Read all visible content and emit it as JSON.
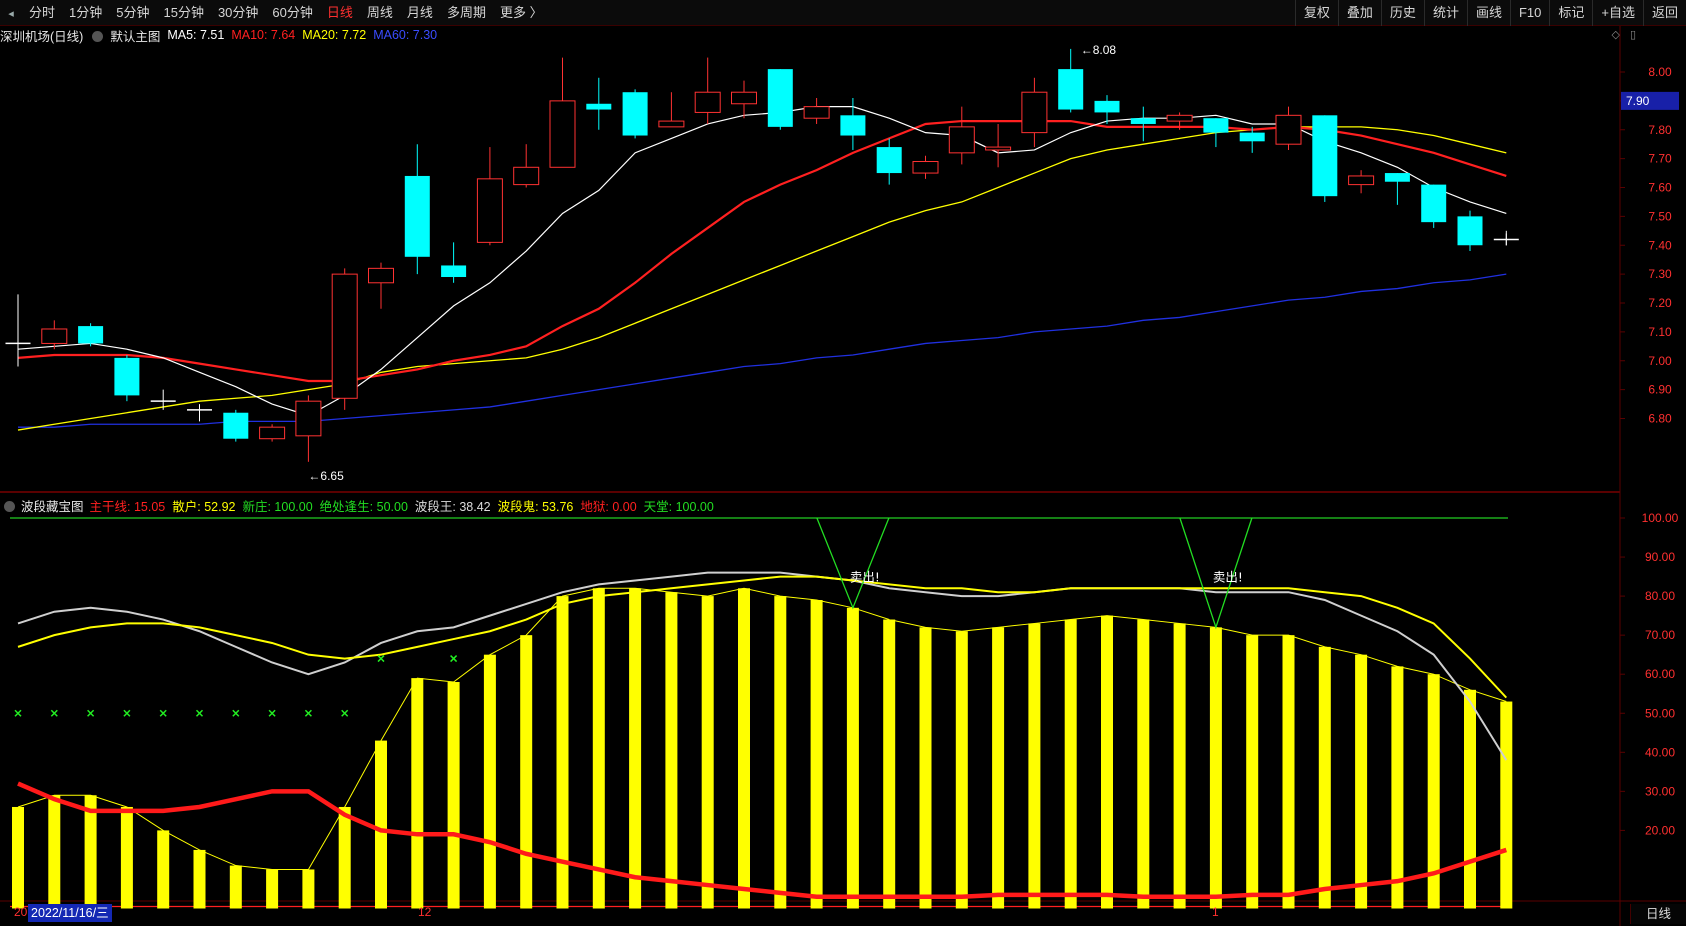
{
  "toolbar": {
    "periods": [
      "分时",
      "1分钟",
      "5分钟",
      "15分钟",
      "30分钟",
      "60分钟",
      "日线",
      "周线",
      "月线",
      "多周期",
      "更多 〉"
    ],
    "active_period": "日线",
    "tools": [
      "复权",
      "叠加",
      "历史",
      "统计",
      "画线",
      "F10",
      "标记",
      "+自选",
      "返回"
    ]
  },
  "main_chart": {
    "stock_name": "深圳机场(日线)",
    "template": "默认主图",
    "ma_legend": [
      {
        "label": "MA5: 7.51",
        "color": "#ffffff"
      },
      {
        "label": "MA10: 7.64",
        "color": "#ff2020"
      },
      {
        "label": "MA20: 7.72",
        "color": "#ffff00"
      },
      {
        "label": "MA60: 7.30",
        "color": "#3a4cff"
      }
    ],
    "high_label": "8.08",
    "low_label": "6.65",
    "current_price": "7.90",
    "y_ticks": [
      "8.00",
      "7.90",
      "7.80",
      "7.70",
      "7.60",
      "7.50",
      "7.40",
      "7.30",
      "7.20",
      "7.10",
      "7.00",
      "6.90",
      "6.80"
    ]
  },
  "indicator": {
    "name": "波段藏宝图",
    "legend": [
      {
        "label": "主干线: 15.05",
        "color": "#ff2020"
      },
      {
        "label": "散户: 52.92",
        "color": "#ffff00"
      },
      {
        "label": "新庄: 100.00",
        "color": "#22dd22"
      },
      {
        "label": "绝处逢生: 50.00",
        "color": "#22dd22"
      },
      {
        "label": "波段王: 38.42",
        "color": "#dddddd"
      },
      {
        "label": "波段鬼: 53.76",
        "color": "#ffff00"
      },
      {
        "label": "地狱: 0.00",
        "color": "#ff2020"
      },
      {
        "label": "天堂: 100.00",
        "color": "#22dd22"
      }
    ],
    "y_ticks": [
      "100.00",
      "90.00",
      "80.00",
      "70.00",
      "60.00",
      "50.00",
      "40.00",
      "30.00",
      "20.00"
    ],
    "sell_labels": [
      "卖出!",
      "卖出!"
    ]
  },
  "x_axis": {
    "marks": [
      "20",
      "12",
      "1"
    ],
    "cursor_date": "2022/11/16/三"
  },
  "chart_data": {
    "type": "candlestick",
    "candles": [
      {
        "o": 7.06,
        "c": 7.06,
        "h": 7.23,
        "l": 6.98
      },
      {
        "o": 7.06,
        "c": 7.11,
        "h": 7.14,
        "l": 7.04
      },
      {
        "o": 7.12,
        "c": 7.06,
        "h": 7.13,
        "l": 7.05
      },
      {
        "o": 7.01,
        "c": 6.88,
        "h": 7.02,
        "l": 6.86
      },
      {
        "o": 6.86,
        "c": 6.86,
        "h": 6.9,
        "l": 6.83
      },
      {
        "o": 6.83,
        "c": 6.83,
        "h": 6.85,
        "l": 6.79
      },
      {
        "o": 6.82,
        "c": 6.73,
        "h": 6.83,
        "l": 6.72
      },
      {
        "o": 6.73,
        "c": 6.77,
        "h": 6.78,
        "l": 6.72
      },
      {
        "o": 6.74,
        "c": 6.86,
        "h": 6.88,
        "l": 6.65
      },
      {
        "o": 6.87,
        "c": 7.3,
        "h": 7.32,
        "l": 6.83
      },
      {
        "o": 7.27,
        "c": 7.32,
        "h": 7.34,
        "l": 7.18
      },
      {
        "o": 7.64,
        "c": 7.36,
        "h": 7.75,
        "l": 7.3
      },
      {
        "o": 7.33,
        "c": 7.29,
        "h": 7.41,
        "l": 7.27
      },
      {
        "o": 7.41,
        "c": 7.63,
        "h": 7.74,
        "l": 7.4
      },
      {
        "o": 7.61,
        "c": 7.67,
        "h": 7.75,
        "l": 7.6
      },
      {
        "o": 7.67,
        "c": 7.9,
        "h": 8.05,
        "l": 7.67
      },
      {
        "o": 7.89,
        "c": 7.87,
        "h": 7.98,
        "l": 7.8
      },
      {
        "o": 7.93,
        "c": 7.78,
        "h": 7.94,
        "l": 7.77
      },
      {
        "o": 7.81,
        "c": 7.83,
        "h": 7.93,
        "l": 7.81
      },
      {
        "o": 7.86,
        "c": 7.93,
        "h": 8.05,
        "l": 7.82
      },
      {
        "o": 7.89,
        "c": 7.93,
        "h": 7.97,
        "l": 7.84
      },
      {
        "o": 8.01,
        "c": 7.81,
        "h": 8.01,
        "l": 7.8
      },
      {
        "o": 7.84,
        "c": 7.88,
        "h": 7.91,
        "l": 7.82
      },
      {
        "o": 7.85,
        "c": 7.78,
        "h": 7.91,
        "l": 7.73
      },
      {
        "o": 7.74,
        "c": 7.65,
        "h": 7.77,
        "l": 7.61
      },
      {
        "o": 7.65,
        "c": 7.69,
        "h": 7.71,
        "l": 7.63
      },
      {
        "o": 7.72,
        "c": 7.81,
        "h": 7.88,
        "l": 7.68
      },
      {
        "o": 7.73,
        "c": 7.74,
        "h": 7.82,
        "l": 7.67
      },
      {
        "o": 7.79,
        "c": 7.93,
        "h": 7.98,
        "l": 7.74
      },
      {
        "o": 8.01,
        "c": 7.87,
        "h": 8.08,
        "l": 7.86
      },
      {
        "o": 7.9,
        "c": 7.86,
        "h": 7.92,
        "l": 7.82
      },
      {
        "o": 7.84,
        "c": 7.82,
        "h": 7.88,
        "l": 7.76
      },
      {
        "o": 7.83,
        "c": 7.85,
        "h": 7.86,
        "l": 7.8
      },
      {
        "o": 7.84,
        "c": 7.79,
        "h": 7.84,
        "l": 7.74
      },
      {
        "o": 7.79,
        "c": 7.76,
        "h": 7.81,
        "l": 7.72
      },
      {
        "o": 7.75,
        "c": 7.85,
        "h": 7.88,
        "l": 7.73
      },
      {
        "o": 7.85,
        "c": 7.57,
        "h": 7.85,
        "l": 7.55
      },
      {
        "o": 7.61,
        "c": 7.64,
        "h": 7.66,
        "l": 7.58
      },
      {
        "o": 7.65,
        "c": 7.62,
        "h": 7.65,
        "l": 7.54
      },
      {
        "o": 7.61,
        "c": 7.48,
        "h": 7.61,
        "l": 7.46
      },
      {
        "o": 7.5,
        "c": 7.4,
        "h": 7.52,
        "l": 7.38
      },
      {
        "o": 7.42,
        "c": 7.42,
        "h": 7.45,
        "l": 7.4
      }
    ],
    "ma5": [
      7.04,
      7.05,
      7.06,
      7.04,
      7.01,
      6.96,
      6.91,
      6.85,
      6.81,
      6.88,
      6.97,
      7.08,
      7.19,
      7.27,
      7.38,
      7.51,
      7.59,
      7.72,
      7.77,
      7.82,
      7.85,
      7.86,
      7.88,
      7.88,
      7.84,
      7.79,
      7.78,
      7.72,
      7.73,
      7.79,
      7.83,
      7.84,
      7.84,
      7.85,
      7.82,
      7.82,
      7.76,
      7.72,
      7.67,
      7.6,
      7.55,
      7.51
    ],
    "ma10": [
      7.01,
      7.02,
      7.02,
      7.02,
      7.01,
      6.99,
      6.97,
      6.95,
      6.93,
      6.93,
      6.95,
      6.97,
      7.0,
      7.02,
      7.05,
      7.12,
      7.18,
      7.27,
      7.37,
      7.46,
      7.55,
      7.61,
      7.66,
      7.72,
      7.77,
      7.82,
      7.83,
      7.83,
      7.83,
      7.83,
      7.81,
      7.81,
      7.81,
      7.81,
      7.8,
      7.81,
      7.8,
      7.78,
      7.75,
      7.72,
      7.68,
      7.64
    ],
    "ma20": [
      6.76,
      6.78,
      6.8,
      6.82,
      6.84,
      6.86,
      6.87,
      6.88,
      6.9,
      6.92,
      6.96,
      6.98,
      6.99,
      7.0,
      7.01,
      7.04,
      7.08,
      7.13,
      7.18,
      7.23,
      7.28,
      7.33,
      7.38,
      7.43,
      7.48,
      7.52,
      7.55,
      7.6,
      7.65,
      7.7,
      7.73,
      7.75,
      7.77,
      7.79,
      7.8,
      7.81,
      7.81,
      7.81,
      7.8,
      7.78,
      7.75,
      7.72
    ],
    "ma60": [
      6.77,
      6.77,
      6.78,
      6.78,
      6.78,
      6.78,
      6.79,
      6.79,
      6.79,
      6.8,
      6.81,
      6.82,
      6.83,
      6.84,
      6.86,
      6.88,
      6.9,
      6.92,
      6.94,
      6.96,
      6.98,
      6.99,
      7.01,
      7.02,
      7.04,
      7.06,
      7.07,
      7.08,
      7.1,
      7.11,
      7.12,
      7.14,
      7.15,
      7.17,
      7.19,
      7.21,
      7.22,
      7.24,
      7.25,
      7.27,
      7.28,
      7.3
    ],
    "ind_bars": [
      26,
      29,
      29,
      26,
      20,
      15,
      11,
      10,
      10,
      26,
      43,
      59,
      58,
      65,
      70,
      80,
      82,
      82,
      81,
      80,
      82,
      80,
      79,
      77,
      74,
      72,
      71,
      72,
      73,
      74,
      75,
      74,
      73,
      72,
      70,
      70,
      67,
      65,
      62,
      60,
      56,
      53
    ],
    "ind_red": [
      32,
      28,
      25,
      25,
      25,
      26,
      28,
      30,
      30,
      24,
      20,
      19,
      19,
      17,
      14,
      12,
      10,
      8,
      7,
      6,
      5,
      4,
      3,
      3,
      3,
      3,
      3,
      3.5,
      3.5,
      3.5,
      3.5,
      3,
      3,
      3,
      3.5,
      3.5,
      5,
      6,
      7,
      9,
      12,
      15
    ],
    "ind_white": [
      73,
      76,
      77,
      76,
      74,
      71,
      67,
      63,
      60,
      63,
      68,
      71,
      72,
      75,
      78,
      81,
      83,
      84,
      85,
      86,
      86,
      86,
      85,
      84,
      82,
      81,
      80,
      80,
      81,
      82,
      82,
      82,
      82,
      81,
      81,
      81,
      79,
      75,
      71,
      65,
      53,
      38
    ],
    "ind_yellow": [
      67,
      70,
      72,
      73,
      73,
      72,
      70,
      68,
      65,
      64,
      65,
      67,
      69,
      71,
      74,
      78,
      80,
      81,
      82,
      83,
      84,
      85,
      85,
      84,
      83,
      82,
      82,
      81,
      81,
      82,
      82,
      82,
      82,
      82,
      82,
      82,
      81,
      80,
      77,
      73,
      64,
      54
    ],
    "green_x_indices": [
      0,
      1,
      2,
      3,
      4,
      5,
      6,
      7,
      8,
      9,
      10,
      12
    ],
    "green_x_value": 50,
    "green_x_values_override": {
      "10": 64,
      "12": 64
    },
    "sell_signals": [
      23,
      33
    ],
    "heaven": 100
  },
  "colors": {
    "up": "#ff3232",
    "down": "#00ffff",
    "ma5": "#ffffff",
    "ma10": "#ff2020",
    "ma20": "#ffff00",
    "ma60": "#2030e0",
    "bar": "#ffff00",
    "grid": "#5a0000",
    "axis_text": "#ff3030",
    "heaven": "#22cc22"
  },
  "status": {
    "period_tab": "日线"
  }
}
